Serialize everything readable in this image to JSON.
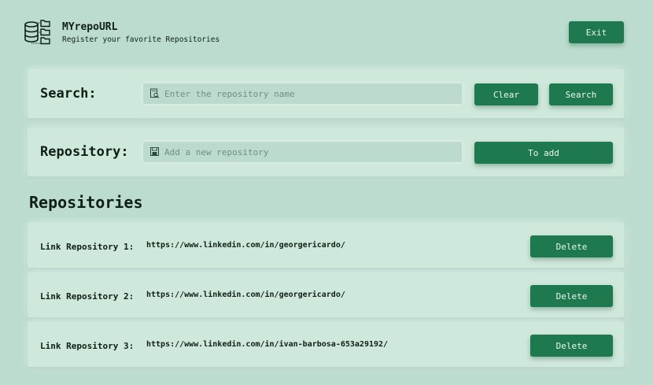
{
  "header": {
    "app_title": "MYrepoURL",
    "subtitle": "Register your favorite Repositories",
    "exit_label": "Exit",
    "logo_icon": "database-folders-icon"
  },
  "search": {
    "label": "Search:",
    "placeholder": "Enter the repository name",
    "value": "",
    "icon": "search-document-icon",
    "clear_label": "Clear",
    "search_label": "Search"
  },
  "add_repo": {
    "label": "Repository:",
    "placeholder": "Add a new repository",
    "value": "",
    "icon": "save-icon",
    "add_label": "To add"
  },
  "repositories": {
    "title": "Repositories",
    "items": [
      {
        "label": "Link Repository 1:",
        "url": "https://www.linkedin.com/in/georgericardo/",
        "delete_label": "Delete"
      },
      {
        "label": "Link Repository 2:",
        "url": "https://www.linkedin.com/in/georgericardo/",
        "delete_label": "Delete"
      },
      {
        "label": "Link Repository 3:",
        "url": "https://www.linkedin.com/in/ivan-barbosa-653a29192/",
        "delete_label": "Delete"
      }
    ]
  },
  "colors": {
    "background": "#bcdccf",
    "panel": "#cfe8dc",
    "accent": "#1e7a4e",
    "text": "#0f1f17"
  }
}
